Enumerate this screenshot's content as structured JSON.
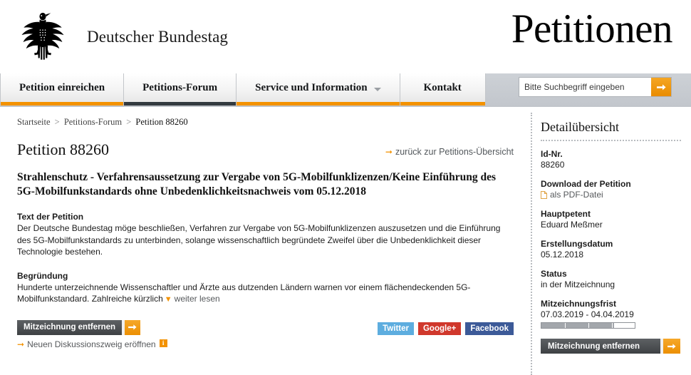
{
  "header": {
    "logo_alt": "Bundesadler",
    "brand": "Deutscher Bundestag",
    "portal": "Petitionen"
  },
  "nav": {
    "items": [
      {
        "label": "Petition einreichen",
        "active": false,
        "caret": false
      },
      {
        "label": "Petitions-Forum",
        "active": true,
        "caret": false
      },
      {
        "label": "Service und Information",
        "active": false,
        "caret": true
      },
      {
        "label": "Kontakt",
        "active": false,
        "caret": false
      }
    ],
    "search": {
      "placeholder": "Bitte Suchbegriff eingeben",
      "value": "",
      "submit_icon": "arrow-right-icon"
    },
    "accent_color": "#f39200",
    "active_color": "#333a3f"
  },
  "breadcrumb": {
    "items": [
      {
        "label": "Startseite"
      },
      {
        "label": "Petitions-Forum"
      },
      {
        "label": "Petition 88260"
      }
    ],
    "separator": ">"
  },
  "main": {
    "page_title": "Petition 88260",
    "back_link": "zurück zur Petitions-Übersicht",
    "petition_title": "Strahlenschutz - Verfahrensaussetzung zur Vergabe von 5G-Mobilfunklizenzen/Keine Einführung des 5G-Mobilfunkstandards ohne Unbedenklichkeitsnachweis vom 05.12.2018",
    "text_heading": "Text der Petition",
    "text_body": "Der Deutsche Bundestag möge beschließen, Verfahren zur Vergabe von 5G-Mobilfunklizenzen auszusetzen und die Einführung des 5G-Mobilfunkstandards zu unterbinden, solange wissenschaftlich begründete Zweifel über die Unbedenklichkeit dieser Technologie bestehen.",
    "reason_heading": "Begründung",
    "reason_body": "Hunderte unterzeichnende Wissenschaftler und Ärzte aus dutzenden Ländern warnen vor einem flächendeckenden 5G-Mobilfunkstandard. Zahlreiche kürzlich",
    "read_more": "weiter lesen",
    "action_button": "Mitzeichnung entfernen",
    "new_thread": "Neuen Diskussionszweig eröffnen",
    "new_thread_badge": "i",
    "social": [
      {
        "label": "Twitter",
        "color": "#5daddf"
      },
      {
        "label": "Google+",
        "color": "#d0382c"
      },
      {
        "label": "Facebook",
        "color": "#3c5a98"
      }
    ]
  },
  "sidebar": {
    "title": "Detailübersicht",
    "blocks": [
      {
        "label": "Id-Nr.",
        "value": "88260"
      },
      {
        "label": "Download der Petition",
        "value": "als PDF-Datei",
        "is_link": true,
        "icon": "pdf-file-icon"
      },
      {
        "label": "Hauptpetent",
        "value": "Eduard Meßmer"
      },
      {
        "label": "Erstellungsdatum",
        "value": "05.12.2018"
      },
      {
        "label": "Status",
        "value": "in der Mitzeichnung"
      },
      {
        "label": "Mitzeichnungsfrist",
        "value": "07.03.2019 - 04.04.2019",
        "progress_percent": 78
      }
    ],
    "action_button": "Mitzeichnung entfernen"
  }
}
